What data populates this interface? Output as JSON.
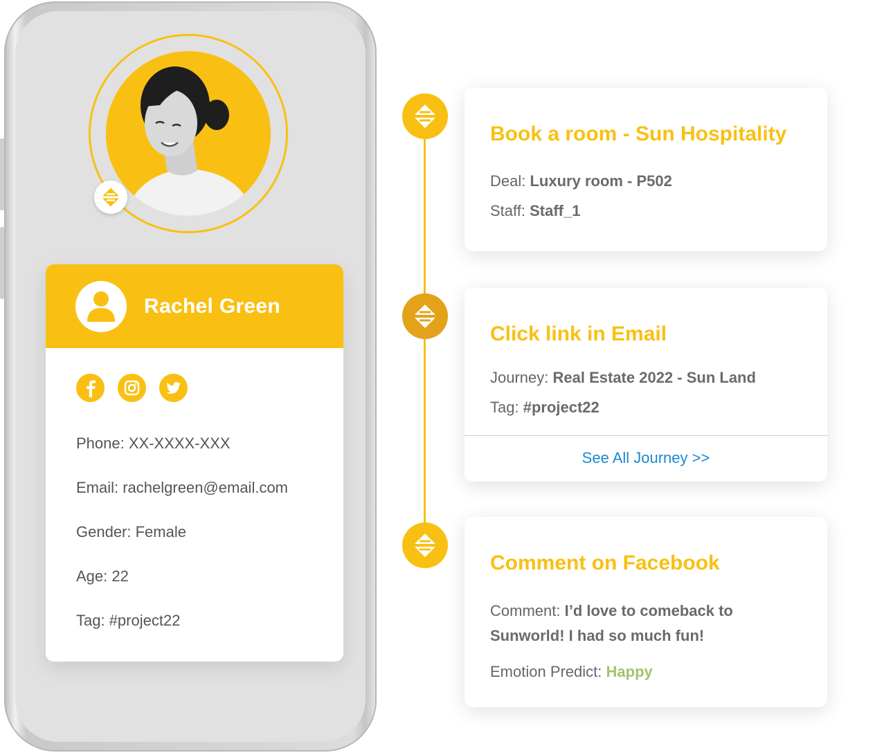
{
  "profile": {
    "name": "Rachel Green",
    "phone": "Phone: XX-XXXX-XXX",
    "email": "Email: rachelgreen@email.com",
    "gender": "Gender: Female",
    "age": "Age: 22",
    "tag": "Tag: #project22",
    "social_icons": [
      "facebook-icon",
      "instagram-icon",
      "twitter-icon"
    ]
  },
  "timeline": [
    {
      "title": "Book a room - Sun Hospitality",
      "lines": [
        {
          "label": "Deal: ",
          "value": "Luxury room - P502"
        },
        {
          "label": "Staff: ",
          "value": "Staff_1"
        }
      ]
    },
    {
      "title": "Click link in Email",
      "lines": [
        {
          "label": "Journey: ",
          "value": "Real Estate 2022 - Sun Land"
        },
        {
          "label": "Tag: ",
          "value": "#project22"
        }
      ],
      "link": "See All Journey >>"
    },
    {
      "title": "Comment on Facebook",
      "lines": [
        {
          "label": "Comment: ",
          "value": "I’d love to comeback to",
          "value2": "Sunworld! I had so much fun!"
        },
        {
          "label": "Emotion Predict: ",
          "value": "Happy"
        }
      ]
    }
  ],
  "colors": {
    "accent": "#f9c013",
    "accent_dark": "#e3a21a",
    "link": "#1a8ad0",
    "happy": "#a3c46a",
    "screen": "#e1e1e1"
  }
}
